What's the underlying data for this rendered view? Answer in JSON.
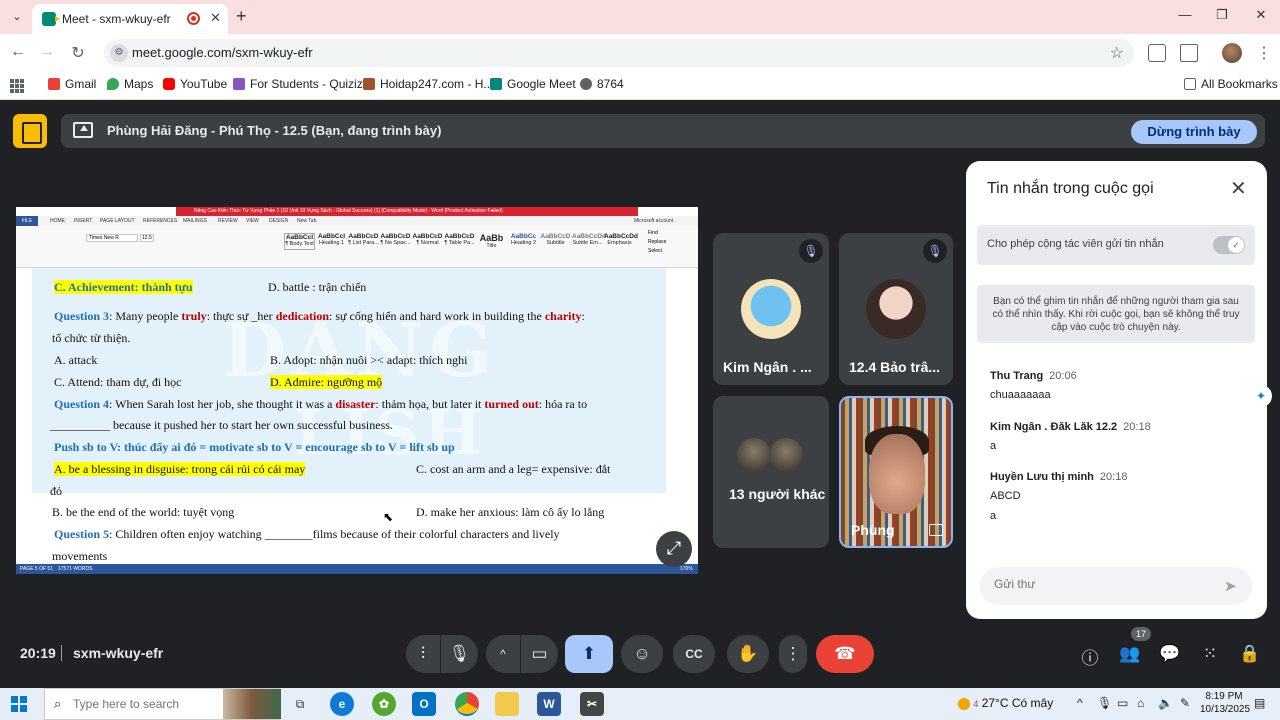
{
  "browser": {
    "tab_title": "Meet - sxm-wkuy-efr",
    "url": "meet.google.com/sxm-wkuy-efr",
    "bookmarks": [
      {
        "label": "Gmail",
        "color": "#ea4335"
      },
      {
        "label": "Maps",
        "color": "#34a853"
      },
      {
        "label": "YouTube",
        "color": "#ff0000"
      },
      {
        "label": "For Students - Quizizz",
        "color": "#8854c0"
      },
      {
        "label": "Hoidap247.com - H...",
        "color": "#a0522d"
      },
      {
        "label": "Google Meet",
        "color": "#00897b"
      },
      {
        "label": "8764",
        "color": "#5f6368"
      }
    ],
    "all_bookmarks": "All Bookmarks"
  },
  "meet": {
    "presenting_text": "Phùng Hải Đăng - Phú Thọ - 12.5 (Bạn, đang trình bày)",
    "stop_presenting": "Dừng trình bày",
    "time": "20:19",
    "meeting_code": "sxm-wkuy-efr",
    "participant_count": "17",
    "colors": {
      "accent": "#a8c7fa",
      "end_call": "#ea4335"
    }
  },
  "doc": {
    "title_bar": "Nâng Cao Kiến Thức Từ Vựng Phần 1 (10 Unit 10 Vựng Sách - Global Success) (1) [Compatibility Mode] - Word (Product Activation Failed)",
    "menu": [
      "FILE",
      "HOME",
      "INSERT",
      "PAGE LAYOUT",
      "REFERENCES",
      "MAILINGS",
      "REVIEW",
      "VIEW",
      "DESIGN",
      "New Tab"
    ],
    "account": "Microsoft account",
    "font_name": "Times New R",
    "font_size": "12.5",
    "styles": [
      {
        "sample": "AaBbCcI",
        "name": "¶ Body Text"
      },
      {
        "sample": "AaBbCcI",
        "name": "Heading 1"
      },
      {
        "sample": "AaBbCcD",
        "name": "¶ List Para..."
      },
      {
        "sample": "AaBbCcD",
        "name": "¶ No Spac..."
      },
      {
        "sample": "AaBbCcD",
        "name": "¶ Normal"
      },
      {
        "sample": "AaBbCcD",
        "name": "¶ Table Pa..."
      },
      {
        "sample": "AaBb",
        "name": "Title"
      },
      {
        "sample": "AaBbCc",
        "name": "Heading 2"
      },
      {
        "sample": "AaBbCcD",
        "name": "Subtitle"
      },
      {
        "sample": "AaBbCcDd",
        "name": "Subtle Em..."
      },
      {
        "sample": "AaBbCcDd",
        "name": "Emphasis"
      }
    ],
    "editing": [
      "Find",
      "Replace",
      "Select"
    ],
    "watermark_1": "DANG",
    "watermark_2": "LISH",
    "status_page": "PAGE 5 OF 51",
    "status_words": "17571 WORDS",
    "status_zoom": "170%",
    "lines": {
      "l1_c": "C. Achievement: thành tựu",
      "l1_d": "D. battle : trận chiến",
      "l2_q": "Question 3",
      "l2_a": ": Many people ",
      "l2_b": "truly",
      "l2_c": ": thực sự _her ",
      "l2_d": "dedication",
      "l2_e": ": sự cống hiến and hard work in building the ",
      "l2_f": "charity",
      "l2_g": ":",
      "l3": "tổ chức từ thiện.",
      "l4_a": "A. attack",
      "l4_b": "B. Adopt: nhận nuôi >< adapt: thích nghi",
      "l5_c": "C. Attend: tham dự, đi học",
      "l5_d": "D. Admire: ngưỡng mộ",
      "l6_q": "Question 4",
      "l6_a": ": When Sarah lost her job, she thought it was a ",
      "l6_b": "disaster",
      "l6_c": ": thảm họa, but later it ",
      "l6_d": "turned out",
      "l6_e": ": hóa ra to",
      "l7": "__________ because it pushed her to start her own successful business.",
      "l8": "Push sb to V: thúc đẩy ai đó = motivate sb to V = encourage sb to V = lift sb up",
      "l9_a": "A. be a blessing in disguise: trong cái rủi có cái may",
      "l9_c": "C. cost an arm and a leg= expensive: đắt",
      "l10": "đỏ",
      "l11_b": "B. be the end of the world: tuyệt vọng",
      "l11_d": "D. make her anxious: làm cô ấy lo lắng",
      "l12_q": "Question 5",
      "l12_a": ": Children often enjoy watching ________films because of their colorful characters and lively",
      "l13": "movements"
    }
  },
  "tiles": [
    {
      "name": "Kim Ngân . ...",
      "muted": true
    },
    {
      "name": "12.4 Bảo trâ...",
      "muted": true
    },
    {
      "name": "13 người khác"
    },
    {
      "name": "Phùng"
    }
  ],
  "chat": {
    "title": "Tin nhắn trong cuộc gọi",
    "allow_label": "Cho phép cộng tác viên gửi tin nhắn",
    "allow_enabled": true,
    "info": "Bạn có thể ghim tin nhắn để những người tham gia sau có thể nhìn thấy. Khi rời cuộc gọi, bạn sẽ không thể truy cập vào cuộc trò chuyện này.",
    "messages": [
      {
        "sender": "Thu Trang",
        "time": "20:06",
        "lines": [
          "chuaaaaaaa"
        ]
      },
      {
        "sender": "Kim Ngân . Đăk Lăk 12.2",
        "time": "20:18",
        "lines": [
          "a"
        ]
      },
      {
        "sender": "Huyền Lưu thị minh",
        "time": "20:18",
        "lines": [
          "ABCD",
          "a"
        ]
      }
    ],
    "input_placeholder": "Gửi thư"
  },
  "taskbar": {
    "search_placeholder": "Type here to search",
    "weather": "27°C  Có mây",
    "weather_badge": "4",
    "time": "8:19 PM",
    "date": "10/13/2025"
  }
}
